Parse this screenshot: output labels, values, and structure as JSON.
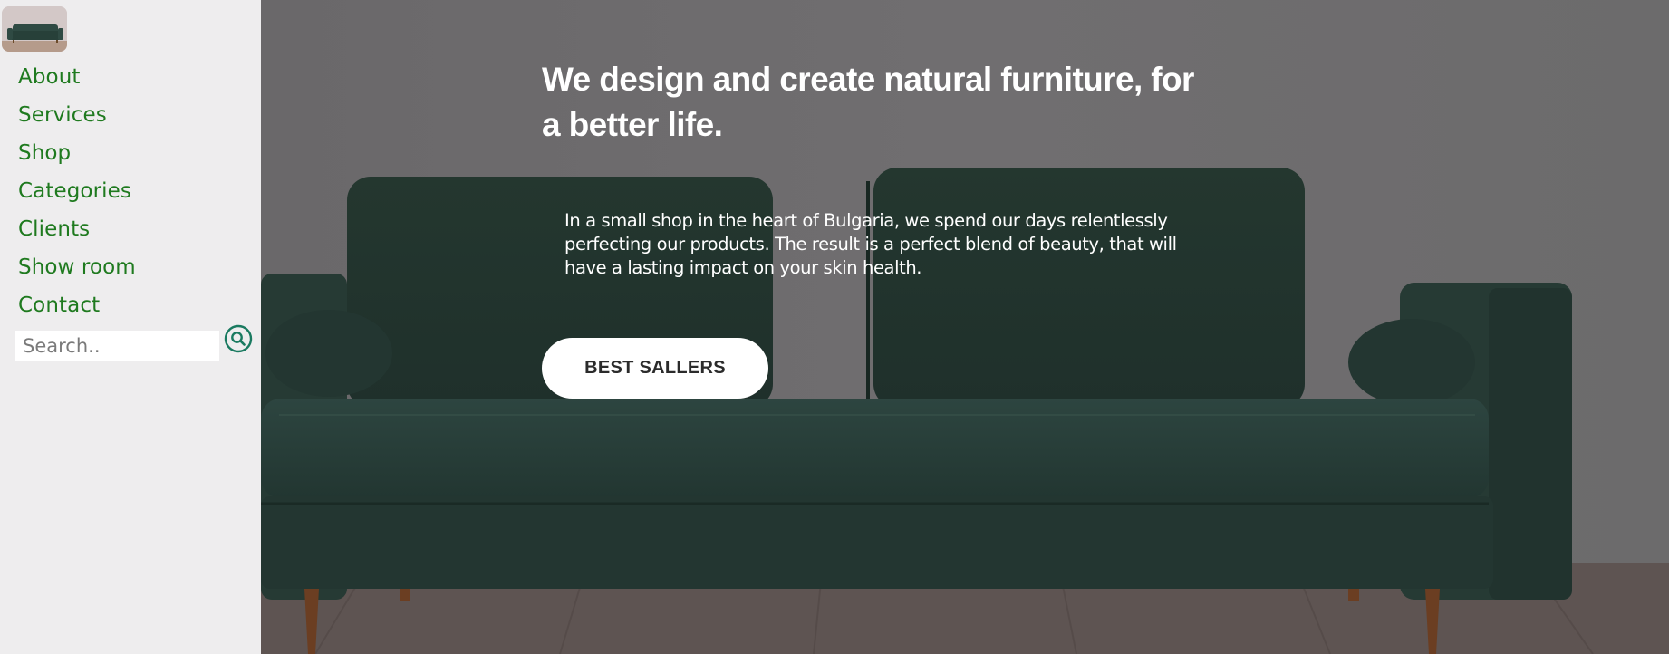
{
  "sidebar": {
    "logo_alt": "green sofa logo",
    "nav": [
      {
        "label": "About"
      },
      {
        "label": "Services"
      },
      {
        "label": "Shop"
      },
      {
        "label": "Categories"
      },
      {
        "label": "Clients"
      },
      {
        "label": "Show room"
      },
      {
        "label": "Contact"
      }
    ],
    "search": {
      "placeholder": "Search..",
      "value": "",
      "icon": "search-icon"
    }
  },
  "hero": {
    "headline": "We design and create natural furniture, for a better life.",
    "lead": "In a small shop in the heart of Bulgaria, we spend our days relentlessly perfecting our products. The result is a perfect blend of beauty, that will have a lasting impact on your skin health.",
    "cta_label": "BEST SALLERS"
  },
  "colors": {
    "nav_link": "#1f7a1f",
    "search_icon": "#1a7a60",
    "sidebar_bg": "#eeedee",
    "hero_overlay": "#6b6a6b",
    "sofa": "#243832",
    "cta_bg": "#ffffff",
    "cta_text": "#2b2b2b"
  }
}
